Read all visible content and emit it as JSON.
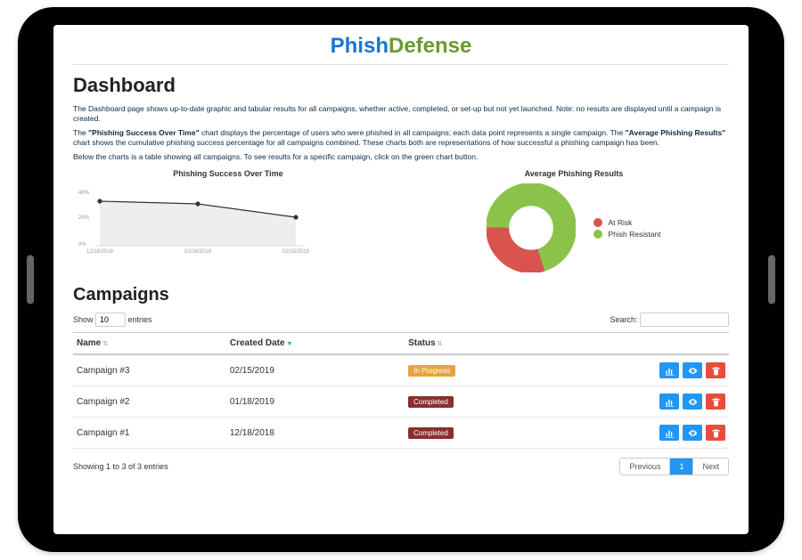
{
  "brand": {
    "part1": "Phish",
    "part2": "Defense"
  },
  "page_title": "Dashboard",
  "description": {
    "p1": "The Dashboard page shows up-to-date graphic and tabular results for all campaigns, whether active, completed, or set-up but not yet launched. Note: no results are displayed until a campaign is created.",
    "p2_a": "The ",
    "p2_b": "\"Phishing Success Over Time\"",
    "p2_c": " chart displays the percentage of users who were phished in all campaigns; each data point represents a single campaign. The ",
    "p2_d": "\"Average Phishing Results\"",
    "p2_e": " chart shows the cumulative phishing success percentage for all campaigns combined. These charts both are representations of how successful a phishing campaign has been.",
    "p3": "Below the charts is a table showing all campaigns. To see results for a specific campaign, click on the green chart button."
  },
  "chart_data": [
    {
      "type": "line",
      "title": "Phishing Success Over Time",
      "categories": [
        "12/18/2018",
        "01/18/2019",
        "02/15/2019"
      ],
      "values": [
        35,
        33,
        25
      ],
      "ylim": [
        0,
        40
      ],
      "yticks": [
        0,
        20,
        40
      ],
      "ytick_labels": [
        "0%",
        "20%",
        "40%"
      ]
    },
    {
      "type": "pie",
      "title": "Average Phishing Results",
      "series": [
        {
          "name": "At Risk",
          "value": 30,
          "color": "#d9534f"
        },
        {
          "name": "Phish Resistant",
          "value": 70,
          "color": "#8bc34a"
        }
      ]
    }
  ],
  "section_campaigns": "Campaigns",
  "table": {
    "show_label_pre": "Show",
    "show_value": "10",
    "show_label_post": "entries",
    "search_label": "Search:",
    "columns": {
      "name": "Name",
      "created": "Created Date",
      "status": "Status"
    },
    "rows": [
      {
        "name": "Campaign #3",
        "created": "02/15/2019",
        "status": "In Progress",
        "status_kind": "inprog"
      },
      {
        "name": "Campaign #2",
        "created": "01/18/2019",
        "status": "Completed",
        "status_kind": "complete"
      },
      {
        "name": "Campaign #1",
        "created": "12/18/2018",
        "status": "Completed",
        "status_kind": "complete"
      }
    ],
    "footer": "Showing 1 to 3 of 3 entries",
    "pager": {
      "prev": "Previous",
      "page": "1",
      "next": "Next"
    }
  }
}
